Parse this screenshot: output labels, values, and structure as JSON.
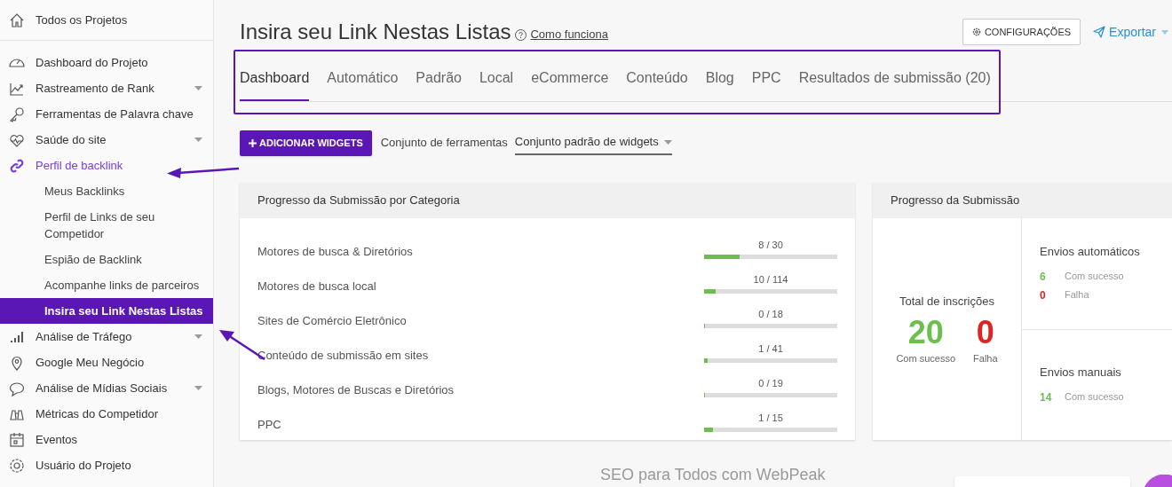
{
  "sidebar": {
    "top_item": {
      "label": "Todos os Projetos"
    },
    "items": [
      {
        "label": "Dashboard do Projeto",
        "kind": "main",
        "caret": false,
        "active": false
      },
      {
        "label": "Rastreamento de Rank",
        "kind": "main",
        "caret": true,
        "active": false
      },
      {
        "label": "Ferramentas de Palavra chave",
        "kind": "main",
        "caret": false,
        "active": false
      },
      {
        "label": "Saúde do site",
        "kind": "main",
        "caret": true,
        "active": false
      },
      {
        "label": "Perfil de backlink",
        "kind": "main",
        "caret": false,
        "active": true
      },
      {
        "label": "Meus Backlinks",
        "kind": "sub",
        "selected": false
      },
      {
        "label": "Perfil de Links de seu Competidor",
        "kind": "sub",
        "selected": false
      },
      {
        "label": "Espião de Backlink",
        "kind": "sub",
        "selected": false
      },
      {
        "label": "Acompanhe links de parceiros",
        "kind": "sub",
        "selected": false
      },
      {
        "label": "Insira seu Link Nestas Listas",
        "kind": "sub",
        "selected": true
      },
      {
        "label": "Análise de Tráfego",
        "kind": "main",
        "caret": true,
        "active": false
      },
      {
        "label": "Google Meu Negócio",
        "kind": "main",
        "caret": false,
        "active": false
      },
      {
        "label": "Análise de Mídias Sociais",
        "kind": "main",
        "caret": true,
        "active": false
      },
      {
        "label": "Métricas do Competidor",
        "kind": "main",
        "caret": false,
        "active": false
      },
      {
        "label": "Eventos",
        "kind": "main",
        "caret": false,
        "active": false
      },
      {
        "label": "Usuário do Projeto",
        "kind": "main",
        "caret": false,
        "active": false
      }
    ]
  },
  "header": {
    "title": "Insira seu Link Nestas Listas",
    "help_link": "Como funciona",
    "settings_button": "CONFIGURAÇÕES",
    "export_button": "Exportar"
  },
  "tabs": [
    {
      "label": "Dashboard",
      "selected": true
    },
    {
      "label": "Automático",
      "selected": false
    },
    {
      "label": "Padrão",
      "selected": false
    },
    {
      "label": "Local",
      "selected": false
    },
    {
      "label": "eCommerce",
      "selected": false
    },
    {
      "label": "Conteúdo",
      "selected": false
    },
    {
      "label": "Blog",
      "selected": false
    },
    {
      "label": "PPC",
      "selected": false
    },
    {
      "label": "Resultados de submissão (20)",
      "selected": false
    }
  ],
  "toolbar": {
    "add_button": "ADICIONAR WIDGETS",
    "toolset_label": "Conjunto de ferramentas",
    "toolset_value": "Conjunto padrão de widgets"
  },
  "category_card": {
    "title": "Progresso da Submissão por Categoria",
    "rows": [
      {
        "label": "Motores de busca & Diretórios",
        "reading": "8 / 30",
        "level": 0.267
      },
      {
        "label": "Motores de busca local",
        "reading": "10 / 114",
        "level": 0.088
      },
      {
        "label": "Sites de Comércio Eletrônico",
        "reading": "0 / 18",
        "level": 0
      },
      {
        "label": "Conteúdo de submissão em sites",
        "reading": "1 / 41",
        "level": 0.024
      },
      {
        "label": "Blogs, Motores de Buscas e Diretórios",
        "reading": "0 / 19",
        "level": 0
      },
      {
        "label": "PPC",
        "reading": "1 / 15",
        "level": 0.067
      }
    ]
  },
  "progress_card": {
    "title": "Progresso da Submissão",
    "total": {
      "label": "Total de inscrições",
      "success_value": "20",
      "success_label": "Com sucesso",
      "fail_value": "0",
      "fail_label": "Falha"
    },
    "sections": [
      {
        "title": "Envios automáticos",
        "stats": [
          {
            "value": "6",
            "label": "Com sucesso",
            "color": "#6cbf4f"
          },
          {
            "value": "0",
            "label": "Falha",
            "color": "#e02424"
          }
        ]
      },
      {
        "title": "Envios manuais",
        "stats": [
          {
            "value": "14",
            "label": "Com sucesso",
            "color": "#6cbf4f"
          }
        ]
      }
    ]
  },
  "footer": {
    "tagline": "SEO para Todos com WebPeak"
  }
}
